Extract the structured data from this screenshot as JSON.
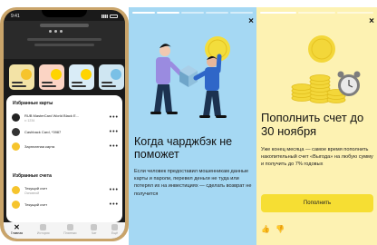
{
  "phone": {
    "status_time": "9:41",
    "favorite_cards_title": "Избранные карты",
    "favorite_cards": [
      {
        "name": "RUB MasterCard World Black E...",
        "sub": "•• 1234",
        "icon_color": "#222222"
      },
      {
        "name": "Cashback Card, *3987",
        "sub": "",
        "icon_color": "#333333"
      },
      {
        "name": "Зарплатная карта",
        "sub": "",
        "icon_color": "#f6c42d"
      }
    ],
    "favorite_accounts_title": "Избранные счета",
    "favorite_accounts": [
      {
        "name": "Текущий счет",
        "sub": "Основной",
        "icon_color": "#f6c42d"
      },
      {
        "name": "Текущий счет",
        "sub": "",
        "icon_color": "#f6c42d"
      }
    ],
    "more_label": "•••",
    "tabs": [
      {
        "label": "Главная",
        "icon": "home-icon"
      },
      {
        "label": "История",
        "icon": "clock-icon"
      },
      {
        "label": "Платежи",
        "icon": "payments-icon"
      },
      {
        "label": "Чат",
        "icon": "chat-icon"
      },
      {
        "label": "Ещё",
        "icon": "menu-icon"
      }
    ],
    "stories": [
      {
        "bg": "#f3e3a6",
        "blob": "#f6c42d"
      },
      {
        "bg": "#fbd4c4",
        "blob": "#ffd400"
      },
      {
        "bg": "#d9ecf7",
        "blob": "#ffd400"
      },
      {
        "bg": "#cfe6f2",
        "blob": "#7ac0e6"
      }
    ]
  },
  "story_chargeback": {
    "close": "×",
    "heading": "Когда чарджбэк не поможет",
    "body": "Если человек предоставил мошенникам данные карты и пароли, перевел деньги не туда или потерял их на инвестициях — сделать возврат не получится",
    "colors": {
      "bg": "#a5d8f3",
      "coin": "#f3dd3c",
      "shirt": "#9a8be0",
      "pants": "#1c3250"
    }
  },
  "story_deposit": {
    "close": "×",
    "heading": "Пополнить счет до 30 ноября",
    "body": "Уже конец месяца — самое время пополнить накопительный счет «Выгода» на любую сумму и получить до 7% годовых",
    "button": "Пополнить",
    "like": "👍",
    "dislike": "👎",
    "colors": {
      "bg": "#fdf2b2",
      "coin": "#f3d73a",
      "button": "#f6de33"
    }
  }
}
